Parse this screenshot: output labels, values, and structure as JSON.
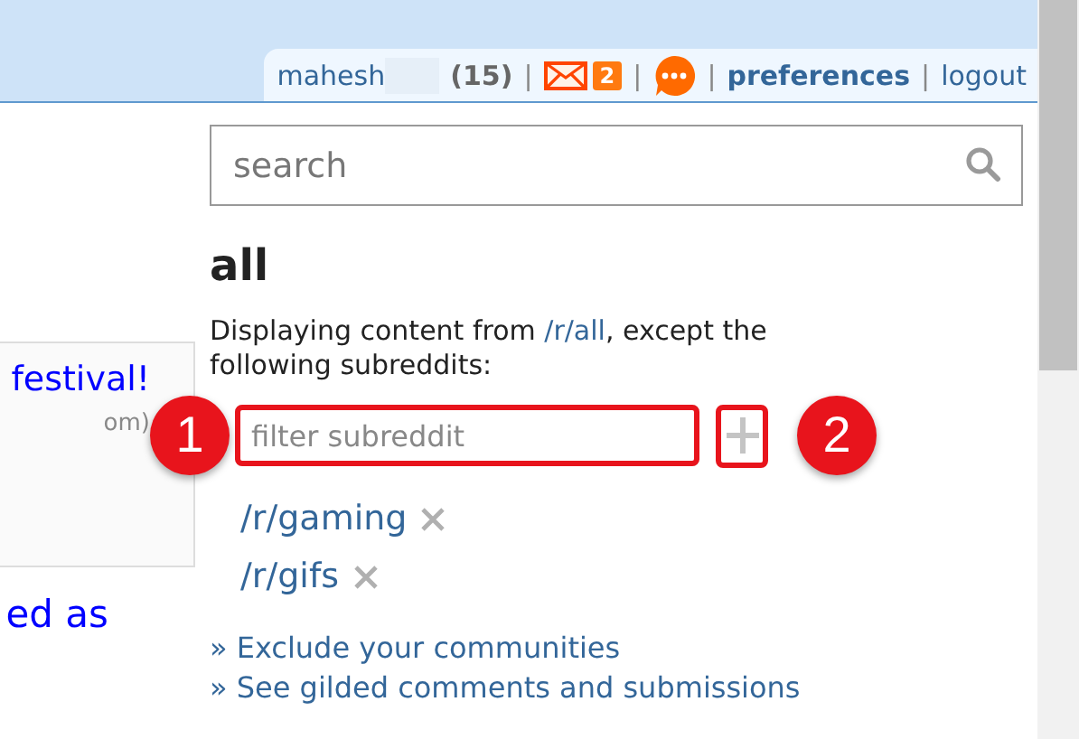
{
  "user_bar": {
    "username": "mahesh",
    "karma": "(15)",
    "items": [
      {
        "kind": "separator",
        "text": "|"
      },
      {
        "kind": "mail",
        "count": "2"
      },
      {
        "kind": "separator",
        "text": "|"
      },
      {
        "kind": "chat"
      },
      {
        "kind": "separator",
        "text": "|"
      },
      {
        "kind": "link",
        "text": "preferences",
        "bold": true
      },
      {
        "kind": "separator",
        "text": "|"
      },
      {
        "kind": "link",
        "text": "logout",
        "bold": false
      }
    ]
  },
  "left_column": {
    "card_title": "festival!",
    "card_domain": "om)",
    "link": "ed as"
  },
  "search": {
    "placeholder": "search"
  },
  "heading": "all",
  "description": {
    "before": "Displaying content from ",
    "link": "/r/all",
    "after": ", except the following subreddits:"
  },
  "filter": {
    "placeholder": "filter subreddit",
    "highlighted": true,
    "add_highlighted": true
  },
  "excluded": [
    {
      "name": "/r/gaming"
    },
    {
      "name": "/r/gifs"
    }
  ],
  "links": [
    {
      "label": "» Exclude your communities"
    },
    {
      "label": "» See gilded comments and submissions"
    }
  ],
  "annotations": [
    {
      "label": "1"
    },
    {
      "label": "2"
    }
  ]
}
